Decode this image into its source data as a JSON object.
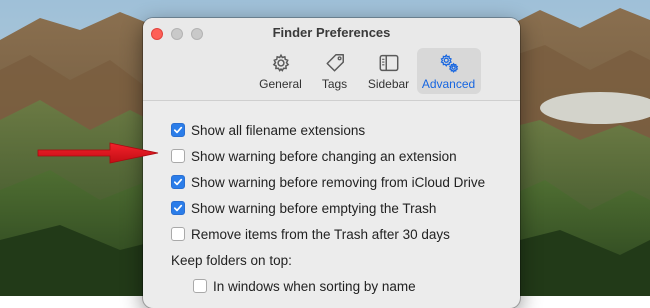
{
  "window": {
    "title": "Finder Preferences"
  },
  "tabs": [
    {
      "label": "General",
      "icon": "gear-icon",
      "active": false
    },
    {
      "label": "Tags",
      "icon": "tag-icon",
      "active": false
    },
    {
      "label": "Sidebar",
      "icon": "sidebar-icon",
      "active": false
    },
    {
      "label": "Advanced",
      "icon": "gears-icon",
      "active": true
    }
  ],
  "options": [
    {
      "label": "Show all filename extensions",
      "checked": true
    },
    {
      "label": "Show warning before changing an extension",
      "checked": false
    },
    {
      "label": "Show warning before removing from iCloud Drive",
      "checked": true
    },
    {
      "label": "Show warning before emptying the Trash",
      "checked": true
    },
    {
      "label": "Remove items from the Trash after 30 days",
      "checked": false
    }
  ],
  "folders_section": {
    "label": "Keep folders on top:",
    "options": [
      {
        "label": "In windows when sorting by name",
        "checked": false
      }
    ]
  },
  "colors": {
    "accent": "#2b7de9",
    "annotation_arrow": "#e0141c",
    "close_button": "#fe5f57"
  }
}
